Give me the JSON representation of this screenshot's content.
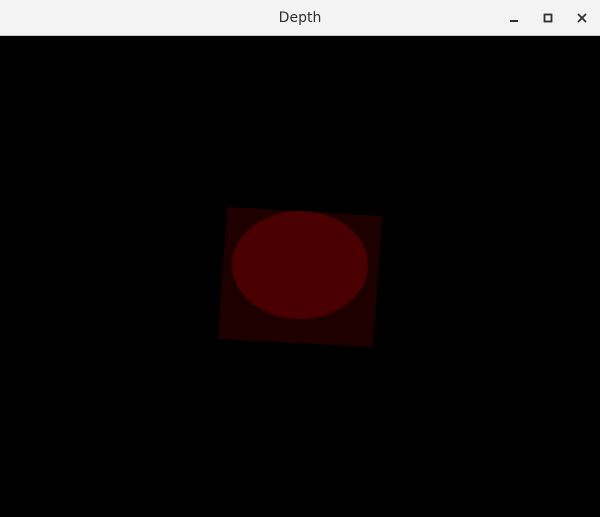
{
  "window": {
    "title": "Depth"
  },
  "controls": {
    "minimize_icon": "minimize-icon",
    "maximize_icon": "maximize-icon",
    "close_icon": "close-icon"
  },
  "colors": {
    "titlebar_bg": "#f3f3f3",
    "canvas_bg": "#000000",
    "quad_fill": "#1f0000",
    "disc_fill": "#4a0000"
  }
}
